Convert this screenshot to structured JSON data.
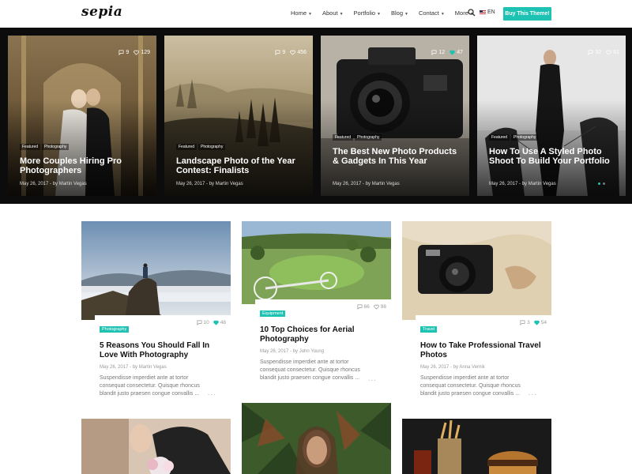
{
  "header": {
    "logo": "sepia",
    "nav": [
      {
        "label": "Home"
      },
      {
        "label": "About"
      },
      {
        "label": "Portfolio"
      },
      {
        "label": "Blog"
      },
      {
        "label": "Contact"
      },
      {
        "label": "More"
      }
    ],
    "lang": "EN",
    "buy_label": "Buy This Theme!"
  },
  "slides": [
    {
      "comments": "9",
      "likes": "129",
      "tags": [
        "Featured",
        "Photography"
      ],
      "title": "More Couples Hiring Pro Photographers",
      "meta": "May 26, 2017 - by Martin Vegas"
    },
    {
      "comments": "9",
      "likes": "456",
      "tags": [
        "Featured",
        "Photography"
      ],
      "title": "Landscape Photo of the Year Contest: Finalists",
      "meta": "May 26, 2017 - by Martin Vegas"
    },
    {
      "comments": "12",
      "likes": "47",
      "tags": [
        "Featured",
        "Photography"
      ],
      "title": "The Best New Photo Products & Gadgets In This Year",
      "meta": "May 26, 2017 - by Martin Vegas"
    },
    {
      "comments": "32",
      "likes": "81",
      "tags": [
        "Featured",
        "Photography"
      ],
      "title": "How To Use A Styled Photo Shoot To Build Your Portfolio",
      "meta": "May 26, 2017 - by Martin Vegas"
    }
  ],
  "cards": [
    {
      "category": "Photography",
      "comments": "10",
      "likes": "48",
      "title": "5 Reasons You Should Fall In Love With Photography",
      "meta": "May 26, 2017 - by Martin Vegas",
      "excerpt": "Suspendisse imperdiet ante at tortor consequat consectetur. Quisque rhoncus blandit justo praesen congue convallis ...",
      "more": "..."
    },
    {
      "category": "Equipment",
      "comments": "66",
      "likes": "98",
      "title": "10 Top Choices for Aerial Photography",
      "meta": "May 26, 2017 - by John Young",
      "excerpt": "Suspendisse imperdiet ante at tortor consequat consectetur. Quisque rhoncus blandit justo praesen congue convallis ...",
      "more": "..."
    },
    {
      "category": "Travel",
      "comments": "3",
      "likes": "54",
      "title": "How to Take Professional Travel Photos",
      "meta": "May 26, 2017 - by Anna Vernik",
      "excerpt": "Suspendisse imperdiet ante at tortor consequat consectetur. Quisque rhoncus blandit justo praesen congue convallis ...",
      "more": "..."
    }
  ],
  "colors": {
    "accent": "#1ec2b3",
    "slider_bg": "#0c0c0c"
  }
}
